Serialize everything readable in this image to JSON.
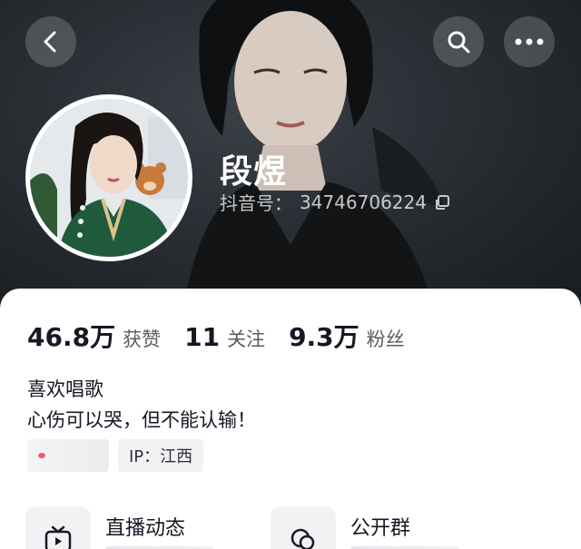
{
  "profile": {
    "name": "段煜",
    "id_label": "抖音号：",
    "id_value": "34746706224"
  },
  "stats": [
    {
      "num": "46.8万",
      "label": "获赞"
    },
    {
      "num": "11",
      "label": "关注"
    },
    {
      "num": "9.3万",
      "label": "粉丝"
    }
  ],
  "bio": {
    "line1": "喜欢唱歌",
    "line2": "心伤可以哭，但不能认输！"
  },
  "tags": {
    "ip": "IP：江西"
  },
  "features": [
    {
      "title": "直播动态",
      "icon": "tv-icon"
    },
    {
      "title": "公开群",
      "icon": "group-chat-icon"
    }
  ],
  "icons": {
    "back": "chevron-left-icon",
    "search": "search-icon",
    "more": "more-dots-icon",
    "copy": "copy-icon"
  },
  "colors": {
    "hero_bg": "#252a2f",
    "text_primary": "#161823",
    "text_secondary": "#5a5c63",
    "accent_dot": "#f25b6b"
  }
}
